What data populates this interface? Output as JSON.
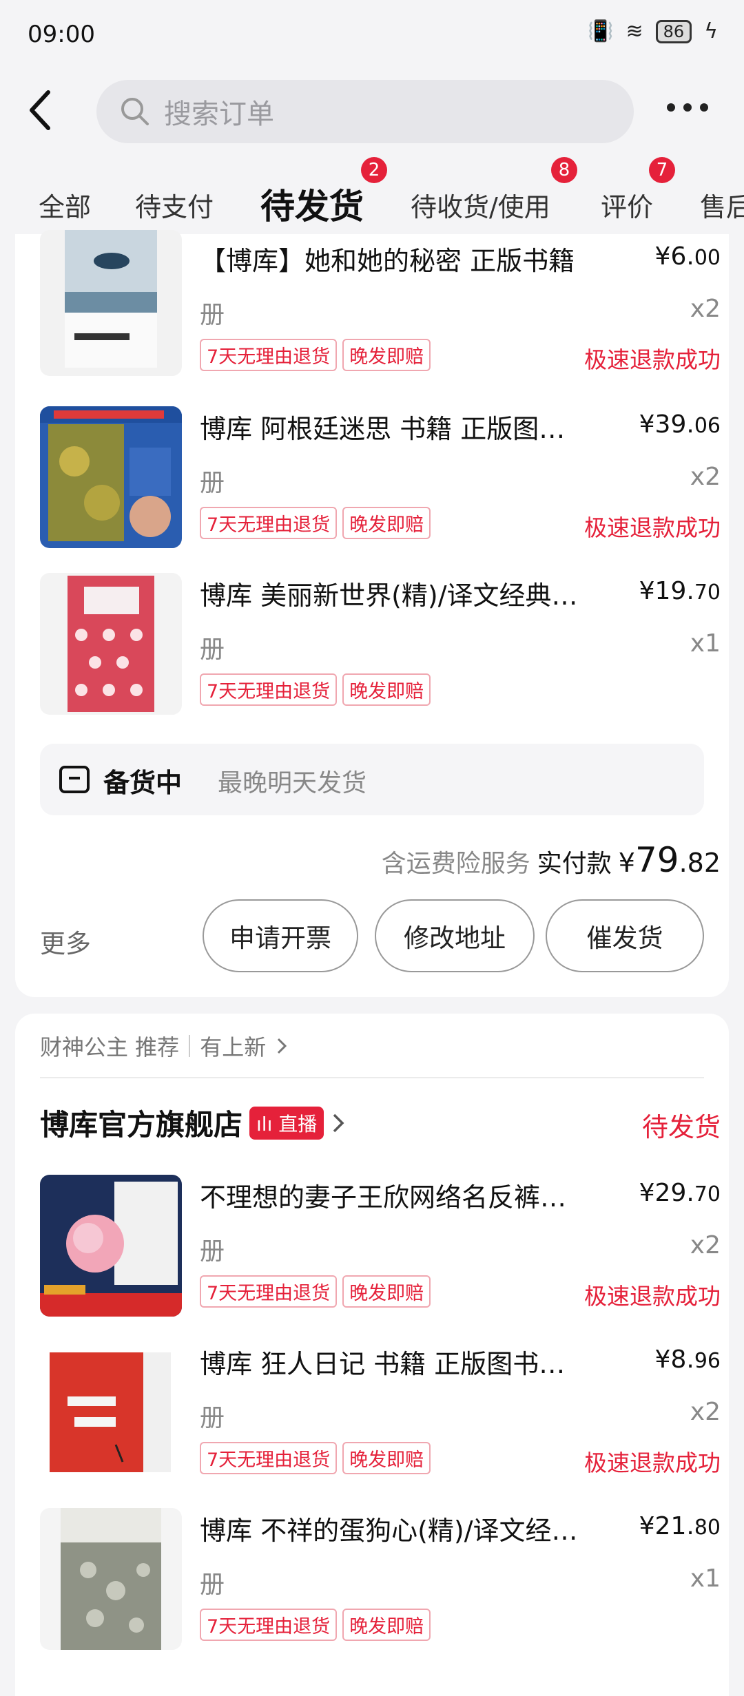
{
  "status_bar": {
    "time": "09:00",
    "battery": "86"
  },
  "search": {
    "placeholder": "搜索订单"
  },
  "tabs": [
    {
      "label": "全部"
    },
    {
      "label": "待支付"
    },
    {
      "label": "待发货",
      "badge": "2",
      "active": true
    },
    {
      "label": "待收货/使用",
      "badge": "8"
    },
    {
      "label": "评价",
      "badge": "7"
    },
    {
      "label": "售后"
    }
  ],
  "order1": {
    "items": [
      {
        "title": "【博库】她和她的秘密 正版书籍",
        "price_int": "¥6.",
        "price_dec": "00",
        "spec": "册",
        "qty": "x2",
        "tags": [
          "7天无理由退货",
          "晚发即赔"
        ],
        "refund": "极速退款成功"
      },
      {
        "title": "博库 阿根廷迷思 书籍 正版图…",
        "price_int": "¥39.",
        "price_dec": "06",
        "spec": "册",
        "qty": "x2",
        "tags": [
          "7天无理由退货",
          "晚发即赔"
        ],
        "refund": "极速退款成功"
      },
      {
        "title": "博库 美丽新世界(精)/译文经典…",
        "price_int": "¥19.",
        "price_dec": "70",
        "spec": "册",
        "qty": "x1",
        "tags": [
          "7天无理由退货",
          "晚发即赔"
        ],
        "refund": ""
      }
    ],
    "notice_status": "备货中",
    "notice_hint": "最晚明天发货",
    "insurance": "含运费险服务",
    "total_label": "实付款",
    "total_prefix": "¥",
    "total_int": "79",
    "total_dec": ".82",
    "more": "更多",
    "buttons": [
      "申请开票",
      "修改地址",
      "催发货"
    ]
  },
  "order2": {
    "reco_left": "财神公主 推荐",
    "reco_right": "有上新",
    "shop_name": "博库官方旗舰店",
    "live_label": "直播",
    "status": "待发货",
    "items": [
      {
        "title": "不理想的妻子王欣网络名反裤…",
        "price_int": "¥29.",
        "price_dec": "70",
        "spec": "册",
        "qty": "x2",
        "tags": [
          "7天无理由退货",
          "晚发即赔"
        ],
        "refund": "极速退款成功"
      },
      {
        "title": "博库 狂人日记 书籍 正版图书推…",
        "price_int": "¥8.",
        "price_dec": "96",
        "spec": "册",
        "qty": "x2",
        "tags": [
          "7天无理由退货",
          "晚发即赔"
        ],
        "refund": "极速退款成功"
      },
      {
        "title": "博库 不祥的蛋狗心(精)/译文经…",
        "price_int": "¥21.",
        "price_dec": "80",
        "spec": "册",
        "qty": "x1",
        "tags": [
          "7天无理由退货",
          "晚发即赔"
        ],
        "refund": ""
      }
    ]
  },
  "colors": {
    "accent": "#e5213a",
    "background": "#f4f4f6"
  }
}
